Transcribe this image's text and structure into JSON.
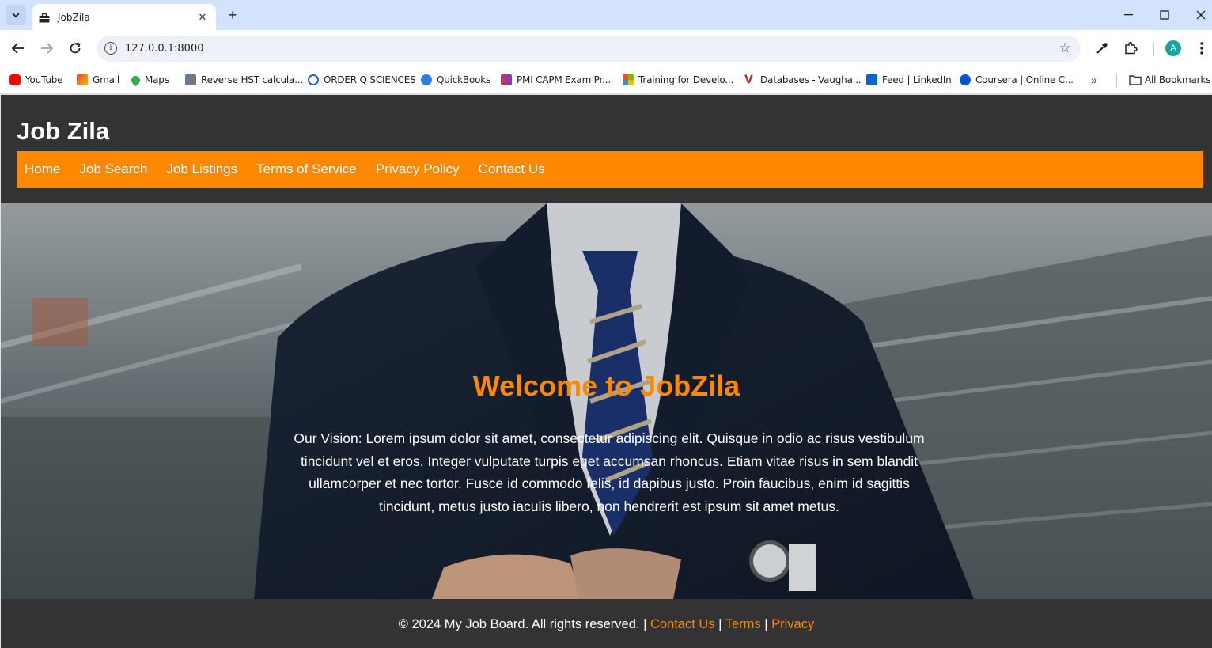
{
  "browser": {
    "tab_title": "JobZila",
    "url": "127.0.0.1:8000",
    "avatar_letter": "A",
    "bookmarks": [
      {
        "label": "YouTube",
        "color": "#ff0000"
      },
      {
        "label": "Gmail",
        "color": "#ea4335"
      },
      {
        "label": "Maps",
        "color": "#34a853"
      },
      {
        "label": "Reverse HST calcula...",
        "color": "#6b7b8c"
      },
      {
        "label": "ORDER Q SCIENCES",
        "color": "#1f5fbf"
      },
      {
        "label": "QuickBooks",
        "color": "#2ca01c"
      },
      {
        "label": "PMI CAPM Exam Pr...",
        "color": "#7a3ec2"
      },
      {
        "label": "Training for Develo...",
        "color": "#f25022"
      },
      {
        "label": "Databases - Vaugha...",
        "color": "#b5332a"
      },
      {
        "label": "Feed | LinkedIn",
        "color": "#0a66c2"
      },
      {
        "label": "Coursera | Online C...",
        "color": "#0056d2"
      }
    ],
    "all_bookmarks_label": "All Bookmarks"
  },
  "site": {
    "title": "Job Zila",
    "nav": [
      "Home",
      "Job Search",
      "Job Listings",
      "Terms of Service",
      "Privacy Policy",
      "Contact Us"
    ],
    "accent_color": "#ff8800"
  },
  "hero": {
    "heading": "Welcome to JobZila",
    "text": "Our Vision: Lorem ipsum dolor sit amet, consectetur adipiscing elit. Quisque in odio ac risus vestibulum tincidunt vel et eros. Integer vulputate turpis eget accumsan rhoncus. Etiam vitae risus in sem blandit ullamcorper et nec tortor. Fusce id commodo felis, id dapibus justo. Proin faucibus, enim id sagittis tincidunt, metus justo iaculis libero, non hendrerit est ipsum sit amet metus."
  },
  "footer": {
    "copyright": "© 2024 My Job Board. All rights reserved.",
    "sep1": " | ",
    "link_contact": "Contact Us",
    "sep2": " | ",
    "link_terms": "Terms",
    "sep3": " | ",
    "link_privacy": "Privacy"
  }
}
